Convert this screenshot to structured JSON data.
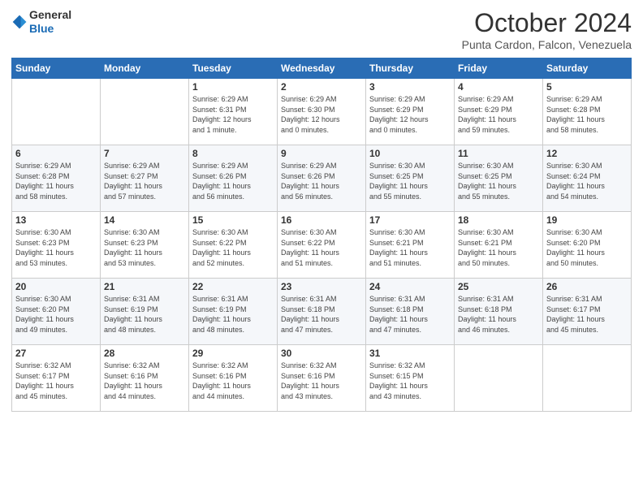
{
  "logo": {
    "line1": "General",
    "line2": "Blue"
  },
  "title": "October 2024",
  "location": "Punta Cardon, Falcon, Venezuela",
  "days_of_week": [
    "Sunday",
    "Monday",
    "Tuesday",
    "Wednesday",
    "Thursday",
    "Friday",
    "Saturday"
  ],
  "weeks": [
    [
      {
        "day": "",
        "content": ""
      },
      {
        "day": "",
        "content": ""
      },
      {
        "day": "1",
        "content": "Sunrise: 6:29 AM\nSunset: 6:31 PM\nDaylight: 12 hours\nand 1 minute."
      },
      {
        "day": "2",
        "content": "Sunrise: 6:29 AM\nSunset: 6:30 PM\nDaylight: 12 hours\nand 0 minutes."
      },
      {
        "day": "3",
        "content": "Sunrise: 6:29 AM\nSunset: 6:29 PM\nDaylight: 12 hours\nand 0 minutes."
      },
      {
        "day": "4",
        "content": "Sunrise: 6:29 AM\nSunset: 6:29 PM\nDaylight: 11 hours\nand 59 minutes."
      },
      {
        "day": "5",
        "content": "Sunrise: 6:29 AM\nSunset: 6:28 PM\nDaylight: 11 hours\nand 58 minutes."
      }
    ],
    [
      {
        "day": "6",
        "content": "Sunrise: 6:29 AM\nSunset: 6:28 PM\nDaylight: 11 hours\nand 58 minutes."
      },
      {
        "day": "7",
        "content": "Sunrise: 6:29 AM\nSunset: 6:27 PM\nDaylight: 11 hours\nand 57 minutes."
      },
      {
        "day": "8",
        "content": "Sunrise: 6:29 AM\nSunset: 6:26 PM\nDaylight: 11 hours\nand 56 minutes."
      },
      {
        "day": "9",
        "content": "Sunrise: 6:29 AM\nSunset: 6:26 PM\nDaylight: 11 hours\nand 56 minutes."
      },
      {
        "day": "10",
        "content": "Sunrise: 6:30 AM\nSunset: 6:25 PM\nDaylight: 11 hours\nand 55 minutes."
      },
      {
        "day": "11",
        "content": "Sunrise: 6:30 AM\nSunset: 6:25 PM\nDaylight: 11 hours\nand 55 minutes."
      },
      {
        "day": "12",
        "content": "Sunrise: 6:30 AM\nSunset: 6:24 PM\nDaylight: 11 hours\nand 54 minutes."
      }
    ],
    [
      {
        "day": "13",
        "content": "Sunrise: 6:30 AM\nSunset: 6:23 PM\nDaylight: 11 hours\nand 53 minutes."
      },
      {
        "day": "14",
        "content": "Sunrise: 6:30 AM\nSunset: 6:23 PM\nDaylight: 11 hours\nand 53 minutes."
      },
      {
        "day": "15",
        "content": "Sunrise: 6:30 AM\nSunset: 6:22 PM\nDaylight: 11 hours\nand 52 minutes."
      },
      {
        "day": "16",
        "content": "Sunrise: 6:30 AM\nSunset: 6:22 PM\nDaylight: 11 hours\nand 51 minutes."
      },
      {
        "day": "17",
        "content": "Sunrise: 6:30 AM\nSunset: 6:21 PM\nDaylight: 11 hours\nand 51 minutes."
      },
      {
        "day": "18",
        "content": "Sunrise: 6:30 AM\nSunset: 6:21 PM\nDaylight: 11 hours\nand 50 minutes."
      },
      {
        "day": "19",
        "content": "Sunrise: 6:30 AM\nSunset: 6:20 PM\nDaylight: 11 hours\nand 50 minutes."
      }
    ],
    [
      {
        "day": "20",
        "content": "Sunrise: 6:30 AM\nSunset: 6:20 PM\nDaylight: 11 hours\nand 49 minutes."
      },
      {
        "day": "21",
        "content": "Sunrise: 6:31 AM\nSunset: 6:19 PM\nDaylight: 11 hours\nand 48 minutes."
      },
      {
        "day": "22",
        "content": "Sunrise: 6:31 AM\nSunset: 6:19 PM\nDaylight: 11 hours\nand 48 minutes."
      },
      {
        "day": "23",
        "content": "Sunrise: 6:31 AM\nSunset: 6:18 PM\nDaylight: 11 hours\nand 47 minutes."
      },
      {
        "day": "24",
        "content": "Sunrise: 6:31 AM\nSunset: 6:18 PM\nDaylight: 11 hours\nand 47 minutes."
      },
      {
        "day": "25",
        "content": "Sunrise: 6:31 AM\nSunset: 6:18 PM\nDaylight: 11 hours\nand 46 minutes."
      },
      {
        "day": "26",
        "content": "Sunrise: 6:31 AM\nSunset: 6:17 PM\nDaylight: 11 hours\nand 45 minutes."
      }
    ],
    [
      {
        "day": "27",
        "content": "Sunrise: 6:32 AM\nSunset: 6:17 PM\nDaylight: 11 hours\nand 45 minutes."
      },
      {
        "day": "28",
        "content": "Sunrise: 6:32 AM\nSunset: 6:16 PM\nDaylight: 11 hours\nand 44 minutes."
      },
      {
        "day": "29",
        "content": "Sunrise: 6:32 AM\nSunset: 6:16 PM\nDaylight: 11 hours\nand 44 minutes."
      },
      {
        "day": "30",
        "content": "Sunrise: 6:32 AM\nSunset: 6:16 PM\nDaylight: 11 hours\nand 43 minutes."
      },
      {
        "day": "31",
        "content": "Sunrise: 6:32 AM\nSunset: 6:15 PM\nDaylight: 11 hours\nand 43 minutes."
      },
      {
        "day": "",
        "content": ""
      },
      {
        "day": "",
        "content": ""
      }
    ]
  ]
}
